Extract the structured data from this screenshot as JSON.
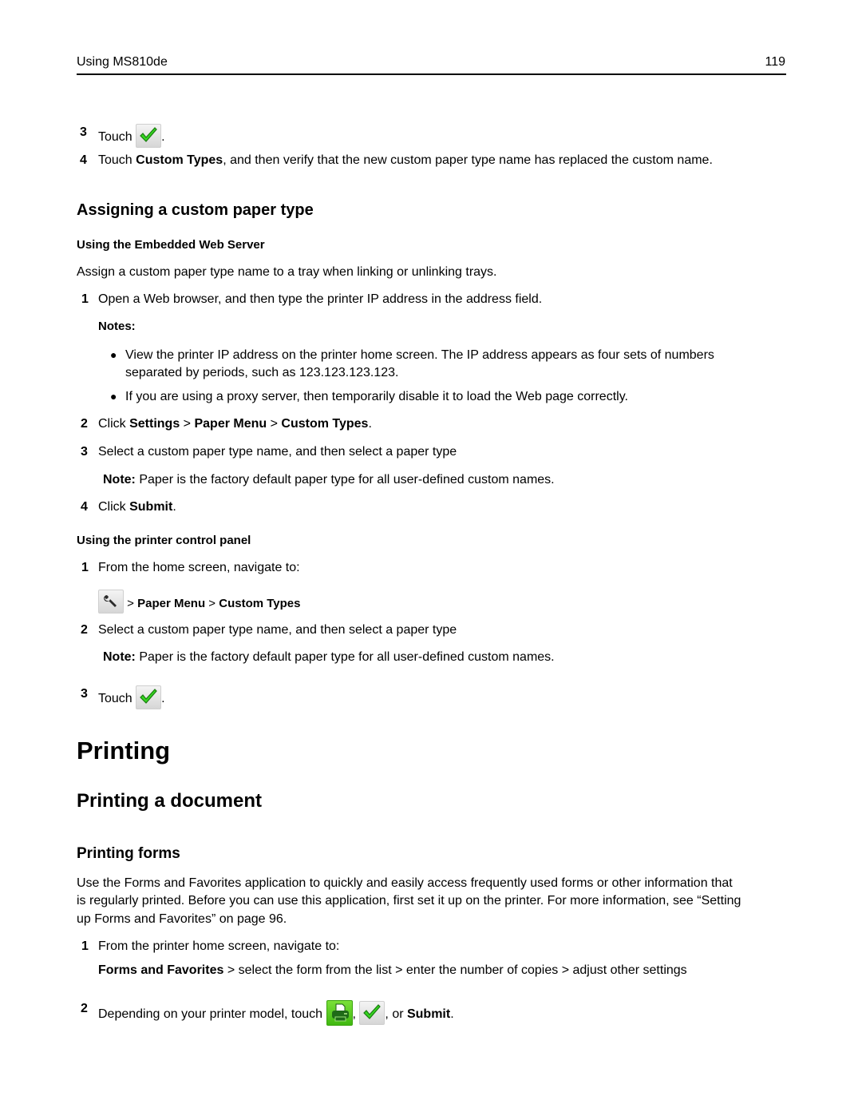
{
  "header": {
    "title": "Using MS810de",
    "page_number": "119"
  },
  "top_steps": [
    {
      "num": "3",
      "text_before": "Touch",
      "icon": "checkmark-icon",
      "text_after": "."
    },
    {
      "num": "4",
      "text_before": "Touch ",
      "bold": "Custom Types",
      "text_after": ", and then verify that the new custom paper type name has replaced the custom name."
    }
  ],
  "assign_section": {
    "heading": "Assigning a custom paper type",
    "ews": {
      "heading": "Using the Embedded Web Server",
      "intro": "Assign a custom paper type name to a tray when linking or unlinking trays.",
      "step1": {
        "num": "1",
        "text": "Open a Web browser, and then type the printer IP address in the address field."
      },
      "notes_label": "Notes:",
      "notes": [
        {
          "line1": "View the printer IP address on the printer home screen. The IP address appears as four sets of numbers",
          "line2": "separated by periods, such as 123.123.123.123."
        },
        {
          "line1": "If you are using a proxy server, then temporarily disable it to load the Web page correctly."
        }
      ],
      "step2": {
        "num": "2",
        "prefix": "Click ",
        "path": [
          "Settings",
          "Paper Menu",
          "Custom Types"
        ],
        "separator": " > ",
        "suffix": "."
      },
      "step3": {
        "num": "3",
        "text": "Select a custom paper type name, and then select a paper type"
      },
      "note": {
        "label": "Note:",
        "text": " Paper is the factory default paper type for all user-defined custom names."
      },
      "step4": {
        "num": "4",
        "prefix": "Click ",
        "bold": "Submit",
        "suffix": "."
      }
    },
    "panel": {
      "heading": "Using the printer control panel",
      "step1": {
        "num": "1",
        "text": "From the home screen, navigate to:"
      },
      "nav": {
        "icon": "wrench-settings-icon",
        "separator": " > ",
        "path": [
          "Paper Menu",
          "Custom Types"
        ]
      },
      "step2": {
        "num": "2",
        "text": "Select a custom paper type name, and then select a paper type"
      },
      "note": {
        "label": "Note:",
        "text": " Paper is the factory default paper type for all user-defined custom names."
      },
      "step3": {
        "num": "3",
        "text_before": "Touch",
        "icon": "checkmark-icon",
        "text_after": "."
      }
    }
  },
  "printing": {
    "heading": "Printing",
    "subheading": "Printing a document",
    "forms": {
      "heading": "Printing forms",
      "para_lines": [
        "Use the Forms and Favorites application to quickly and easily access frequently used forms or other information that",
        "is regularly printed. Before you can use this application, first set it up on the printer. For more information, see “Setting",
        "up Forms and Favorites” on page 96."
      ],
      "step1": {
        "num": "1",
        "text": "From the printer home screen, navigate to:"
      },
      "nav": {
        "bold": "Forms and Favorites",
        "rest": " > select the form from the list > enter the number of copies > adjust other settings"
      },
      "step2": {
        "num": "2",
        "prefix": "Depending on your printer model, touch",
        "comma1": ",",
        "comma2": ", or ",
        "bold": "Submit",
        "suffix": "."
      }
    }
  }
}
